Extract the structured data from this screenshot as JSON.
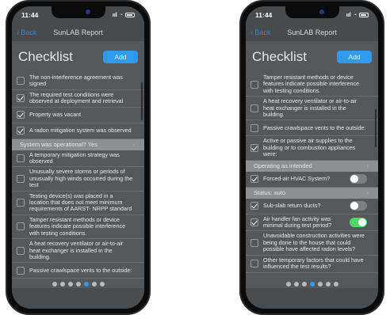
{
  "left": {
    "status_time": "11:44",
    "status_icons": "ııl",
    "nav_back": "Back",
    "nav_title": "SunLAB Report",
    "title": "Checklist",
    "add_label": "Add",
    "items": [
      {
        "text": "The non-interference agreement was signed",
        "checked": false
      },
      {
        "text": "The required test conditions were observed at deployment and retrieval",
        "checked": true
      },
      {
        "text": "Property was vacant",
        "checked": true
      },
      {
        "text": "A radon mitigation system was observed",
        "checked": true
      }
    ],
    "band": "System was operational? Yes",
    "items2": [
      {
        "text": "A temporary mitigation strategy was observed",
        "checked": false
      },
      {
        "text": "Unusually severe storms or periods of unusually high winds occurred during the test",
        "checked": false
      },
      {
        "text": "Testing device(s) was placed in a location that does not meet minimum requirements of AARST- NRPP standard",
        "checked": false
      },
      {
        "text": "Tamper resistant methods or device features indicate possible interference with testing conditions.",
        "checked": false
      },
      {
        "text": "A heat recovery ventilator or air-to-air heat exchanger is installed in the building.",
        "checked": false
      },
      {
        "text": "Passive crawlspace vents to the outside:",
        "checked": false
      }
    ],
    "page_dots": 7,
    "active_dot": 4
  },
  "right": {
    "status_time": "11:44",
    "status_icons": "ııl",
    "nav_back": "Back",
    "nav_title": "SunLAB Report",
    "title": "Checklist",
    "add_label": "Add",
    "items": [
      {
        "text": "Tamper resistant methods or device features indicate possible interference with testing conditions.",
        "checked": false
      },
      {
        "text": "A heat recovery ventilator or air-to-air heat exchanger is installed in the building.",
        "checked": false
      },
      {
        "text": "Passive crawlspace vents to the outside:",
        "checked": false
      },
      {
        "text": "Active or passive air supplies to the building or to combustion appliances were:",
        "checked": true
      }
    ],
    "band1": "Operating as intended",
    "hvac": {
      "text": "Forced-air HVAC System?",
      "checked": true,
      "on": false
    },
    "band2": "Status: auto",
    "subslab": {
      "text": "Sub-slab return ducts?",
      "checked": true,
      "on": false
    },
    "airhandler": {
      "text": "Air handler fan activity was minimal during test period?",
      "checked": true,
      "on": true
    },
    "items3": [
      {
        "text": "Unavoidable construction activities were being done to the house that could possible have affected radon levels?",
        "checked": false
      },
      {
        "text": "Other temporary factors that could have influenced the test results?",
        "checked": false
      }
    ],
    "page_dots": 7,
    "active_dot": 3
  }
}
